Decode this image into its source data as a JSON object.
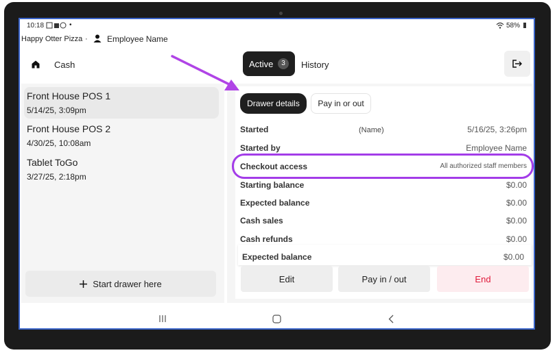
{
  "status_bar": {
    "time": "10:18",
    "dot": "•",
    "battery": "58%"
  },
  "header": {
    "store_name": "Happy Otter Pizza",
    "separator": "·",
    "employee": "Employee Name"
  },
  "nav": {
    "title": "Cash"
  },
  "tabs": {
    "active_label": "Active",
    "active_count": "3",
    "history_label": "History"
  },
  "drawers": [
    {
      "name": "Front House POS 1",
      "date": "5/14/25, 3:09pm"
    },
    {
      "name": "Front House POS 2",
      "date": "4/30/25, 10:08am"
    },
    {
      "name": "Tablet ToGo",
      "date": "3/27/25, 2:18pm"
    }
  ],
  "start_drawer_label": "Start drawer here",
  "detail_tabs": {
    "drawer_details": "Drawer details",
    "pay_in_out": "Pay in or out"
  },
  "details": {
    "started_label": "Started",
    "started_name": "(Name)",
    "started_value": "5/16/25, 3:26pm",
    "started_by_label": "Started by",
    "started_by_value": "Employee Name",
    "checkout_label": "Checkout access",
    "checkout_value": "All authorized staff members",
    "starting_balance_label": "Starting balance",
    "starting_balance_value": "$0.00",
    "expected_balance_label": "Expected balance",
    "expected_balance_value": "$0.00",
    "cash_sales_label": "Cash sales",
    "cash_sales_value": "$0.00",
    "cash_refunds_label": "Cash refunds",
    "cash_refunds_value": "$0.00",
    "expected_balance2_label": "Expected balance",
    "expected_balance2_value": "$0.00"
  },
  "actions": {
    "edit": "Edit",
    "pay_in_out": "Pay in / out",
    "end": "End"
  },
  "colors": {
    "highlight": "#a33ce8",
    "arrow": "#b044e6",
    "end_text": "#e0193a",
    "end_bg": "#fdecef",
    "screen_border": "#3a64c9"
  },
  "icons": [
    "home-icon",
    "person-icon",
    "exit-icon",
    "plus-icon",
    "recent-apps-icon",
    "home-circle-icon",
    "back-icon",
    "wifi-icon",
    "battery-icon"
  ]
}
